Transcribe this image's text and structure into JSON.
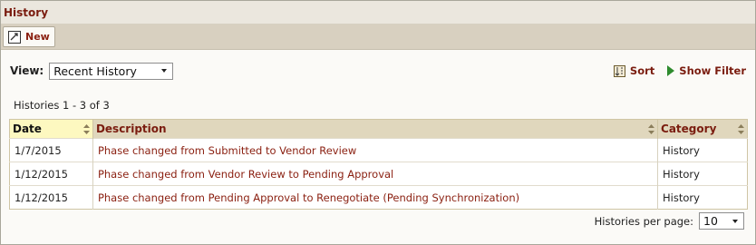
{
  "panel": {
    "title": "History"
  },
  "toolbar": {
    "new_label": "New"
  },
  "view": {
    "label": "View:",
    "selected": "Recent History"
  },
  "actions": {
    "sort_label": "Sort",
    "filter_label": "Show Filter"
  },
  "count_text": "Histories 1 - 3 of 3",
  "table": {
    "headers": [
      "Date",
      "Description",
      "Category"
    ],
    "rows": [
      {
        "date": "1/7/2015",
        "description": "Phase changed from Submitted to Vendor Review",
        "category": "History"
      },
      {
        "date": "1/12/2015",
        "description": "Phase changed from Vendor Review to Pending Approval",
        "category": "History"
      },
      {
        "date": "1/12/2015",
        "description": "Phase changed from Pending Approval to Renegotiate (Pending Synchronization)",
        "category": "History"
      }
    ]
  },
  "pager": {
    "label": "Histories per page:",
    "value": "10"
  },
  "colors": {
    "accent": "#7a1c0f",
    "header_bg": "#e0d7bd",
    "active_header_bg": "#fdf8c0",
    "filter_icon": "#2e8b2e"
  },
  "icons": {
    "new": "new-document-icon",
    "sort": "sort-icon",
    "filter": "play-arrow-icon"
  }
}
